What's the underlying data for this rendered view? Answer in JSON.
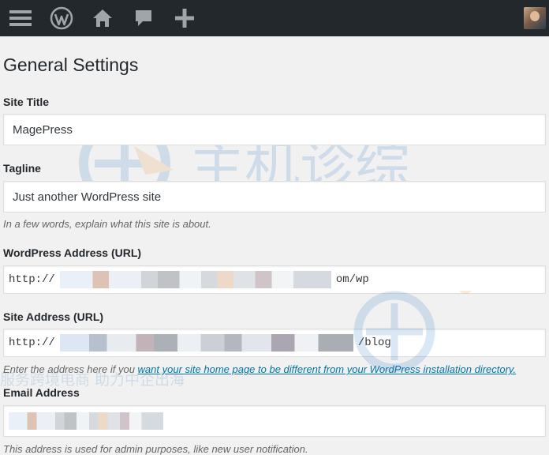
{
  "admin_bar": {
    "icons": [
      "menu-icon",
      "wordpress-logo-icon",
      "home-icon",
      "comments-icon",
      "add-new-icon"
    ]
  },
  "page": {
    "title": "General Settings"
  },
  "fields": {
    "site_title": {
      "label": "Site Title",
      "value": "MagePress"
    },
    "tagline": {
      "label": "Tagline",
      "value": "Just another WordPress site",
      "description": "In a few words, explain what this site is about."
    },
    "wordpress_address": {
      "label": "WordPress Address (URL)",
      "value_prefix": "http://",
      "value_suffix": "om/wp"
    },
    "site_address": {
      "label": "Site Address (URL)",
      "value_prefix": "http://",
      "value_suffix": "/blog",
      "description_prefix": "Enter the address here if you ",
      "description_link": "want your site home page to be different from your WordPress installation directory."
    },
    "email_address": {
      "label": "Email Address",
      "description": "This address is used for admin purposes, like new user notification."
    }
  },
  "watermark": {
    "brand": "主机诊综",
    "slogan": "服务跨境电商 助力中企出海"
  },
  "colors": {
    "admin_bar_bg": "#23282d",
    "page_bg": "#f1f1f1",
    "link": "#0073aa",
    "icon": "#a0a5aa"
  }
}
